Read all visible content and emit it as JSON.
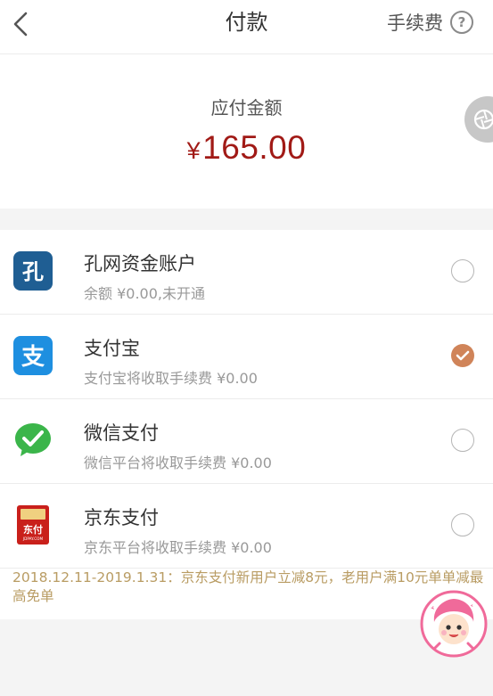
{
  "header": {
    "title": "付款",
    "fee_label": "手续费",
    "help_icon": "?"
  },
  "amount": {
    "label": "应付金额",
    "currency": "¥",
    "value": "165.00"
  },
  "methods": [
    {
      "name": "孔网资金账户",
      "desc": "余额 ¥0.00,未开通",
      "icon": "kongwang-icon",
      "icon_text": "孔",
      "selected": false
    },
    {
      "name": "支付宝",
      "desc": "支付宝将收取手续费 ¥0.00",
      "icon": "alipay-icon",
      "icon_text": "支",
      "selected": true
    },
    {
      "name": "微信支付",
      "desc": "微信平台将收取手续费 ¥0.00",
      "icon": "wechat-pay-icon",
      "selected": false
    },
    {
      "name": "京东支付",
      "desc": "京东平台将收取手续费 ¥0.00",
      "icon": "jdpay-icon",
      "icon_text": "东付",
      "icon_subtext": "JDPAY.COM",
      "selected": false
    }
  ],
  "promo": "2018.12.11-2019.1.31：京东支付新用户立减8元，老用户满10元单单减最高免单",
  "colors": {
    "amount": "#a11a16",
    "checked": "#d08459",
    "promo": "#b99c63",
    "alipay": "#1e8fe0",
    "wechat": "#3bb54a",
    "jd": "#c9201b",
    "kongwang": "#1f5e93"
  }
}
